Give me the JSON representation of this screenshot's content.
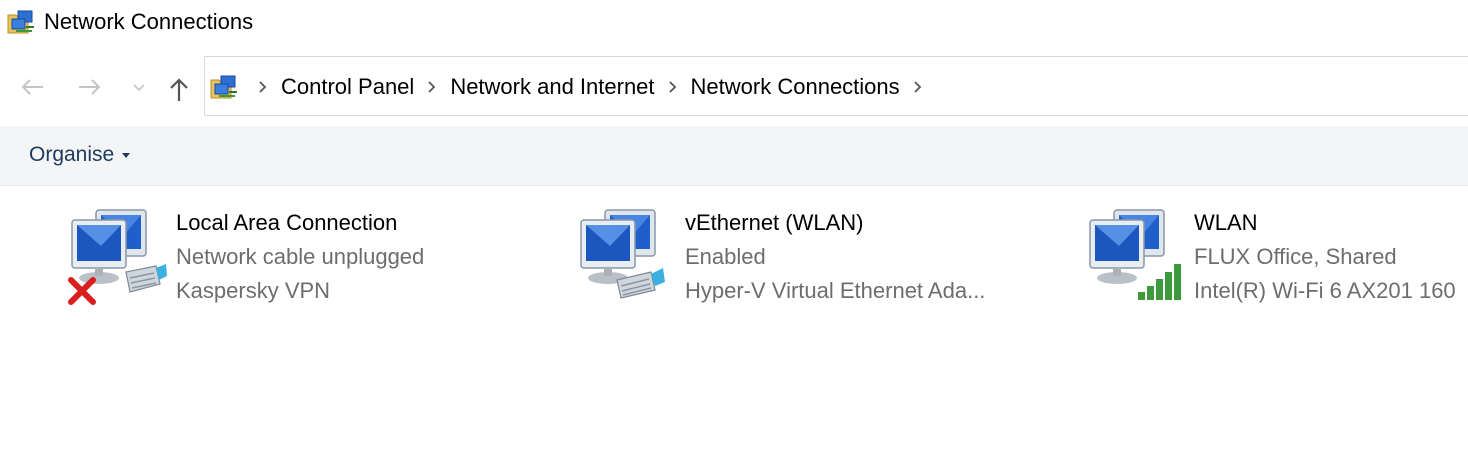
{
  "window": {
    "title": "Network Connections"
  },
  "nav": {
    "breadcrumb": [
      {
        "label": "Control Panel"
      },
      {
        "label": "Network and Internet"
      },
      {
        "label": "Network Connections"
      }
    ]
  },
  "toolbar": {
    "organise_label": "Organise"
  },
  "connections": [
    {
      "name": "Local Area Connection",
      "status": "Network cable unplugged",
      "device": "Kaspersky VPN",
      "overlay": "red-x-icon"
    },
    {
      "name": "vEthernet (WLAN)",
      "status": "Enabled",
      "device": "Hyper-V Virtual Ethernet Ada...",
      "overlay": "ethernet-cable-icon"
    },
    {
      "name": "WLAN",
      "status": "FLUX Office, Shared",
      "device": "Intel(R) Wi-Fi 6 AX201 160",
      "overlay": "wifi-signal-icon"
    }
  ],
  "colors": {
    "command_bar_bg": "#f4f5f7",
    "organise_text": "#1e3a5c",
    "secondary_text": "#6d6d6d",
    "disconnected": "#d81e1e",
    "signal": "#3c9a3c"
  }
}
